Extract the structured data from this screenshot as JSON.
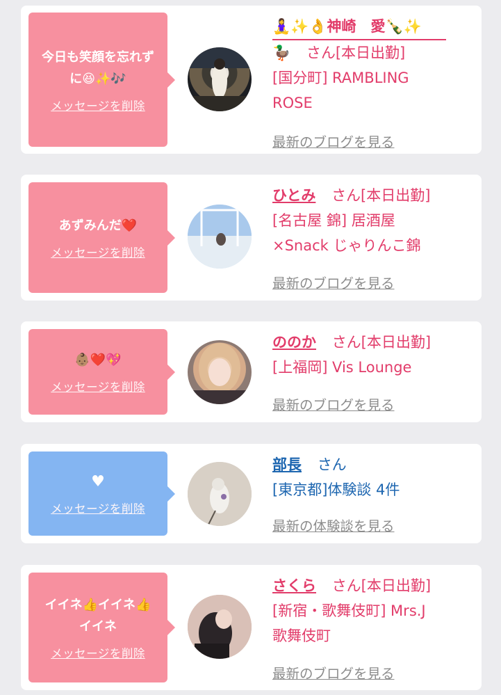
{
  "cards": [
    {
      "theme": "pink",
      "message": "今日も笑顔を忘れずに😆✨🎶",
      "delete_label": "メッセージを削除",
      "name": "🧘‍♀️✨👌神崎　愛🍾✨",
      "name_line2": "🦆",
      "suffix": "さん[本日出勤]",
      "lines": [
        "[国分町] RAMBLING",
        "ROSE"
      ],
      "link": "最新のブログを見る",
      "avatar_icon": "photo-avatar"
    },
    {
      "theme": "pink",
      "message": "あずみんだ❤️",
      "delete_label": "メッセージを削除",
      "name": "ひとみ",
      "suffix": "さん[本日出勤]",
      "lines": [
        "[名古屋 錦] 居酒屋",
        "×Snack じゃりんこ錦"
      ],
      "link": "最新のブログを見る",
      "avatar_icon": "photo-avatar"
    },
    {
      "theme": "pink",
      "message": "👶🏽❤️💖",
      "delete_label": "メッセージを削除",
      "name": "ののか",
      "suffix": "さん[本日出勤]",
      "lines": [
        "[上福岡] Vis Lounge"
      ],
      "link": "最新のブログを見る",
      "avatar_icon": "photo-avatar"
    },
    {
      "theme": "blue",
      "message": "♥",
      "delete_label": "メッセージを削除",
      "name": "部長",
      "suffix": "さん",
      "lines": [
        "[東京都]体験談 4件"
      ],
      "link": "最新の体験談を見る",
      "avatar_icon": "photo-avatar"
    },
    {
      "theme": "pink",
      "message": "イイネ👍イイネ👍イイネ",
      "delete_label": "メッセージを削除",
      "name": "さくら",
      "suffix": "さん[本日出勤]",
      "lines": [
        "[新宿・歌舞伎町] Mrs.J",
        "歌舞伎町"
      ],
      "link": "最新のブログを見る",
      "avatar_icon": "photo-avatar"
    }
  ],
  "colors": {
    "pink": "#f7909f",
    "blue": "#84b5f2",
    "name_pink": "#e23c6a",
    "name_blue": "#1d66b0"
  }
}
